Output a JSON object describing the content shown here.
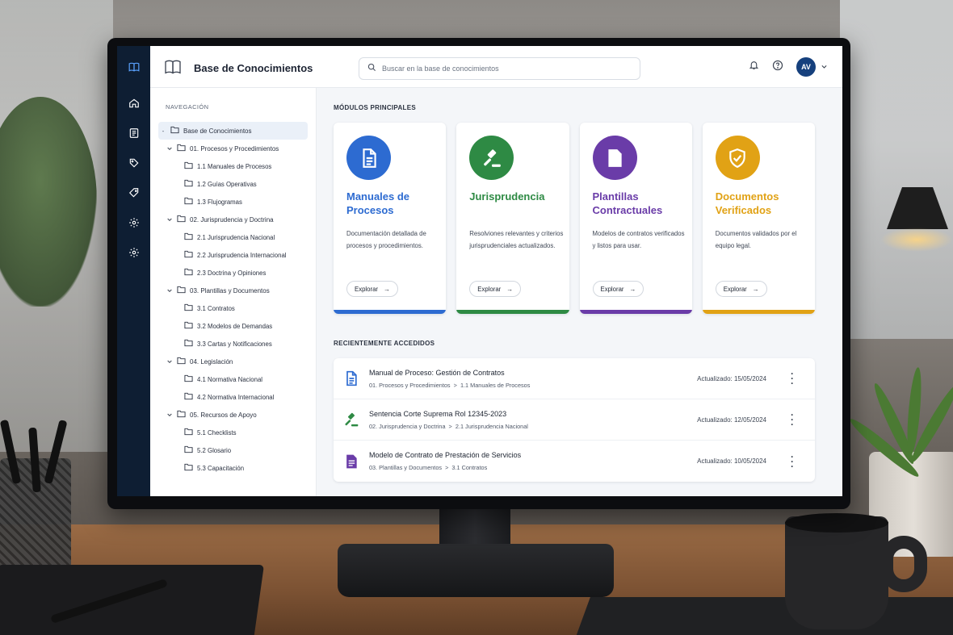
{
  "app": {
    "title": "Base de Conocimientos",
    "user_initials": "AV"
  },
  "search": {
    "placeholder": "Buscar en la base de conocimientos"
  },
  "rail": {
    "items": [
      "home-icon",
      "document-icon",
      "tag-icon",
      "label-icon",
      "settings-icon",
      "gear-icon"
    ]
  },
  "nav": {
    "heading": "NAVEGACIÓN",
    "root": "Base de Conocimientos",
    "groups": [
      {
        "label": "01. Procesos y Procedimientos",
        "items": [
          "1.1 Manuales de Procesos",
          "1.2 Guías Operativas",
          "1.3 Flujogramas"
        ]
      },
      {
        "label": "02. Jurisprudencia y Doctrina",
        "items": [
          "2.1 Jurisprudencia Nacional",
          "2.2 Jurisprudencia Internacional",
          "2.3 Doctrina y Opiniones"
        ]
      },
      {
        "label": "03. Plantillas y Documentos",
        "items": [
          "3.1 Contratos",
          "3.2 Modelos de Demandas",
          "3.3 Cartas y Notificaciones"
        ]
      },
      {
        "label": "04. Legislación",
        "items": [
          "4.1 Normativa Nacional",
          "4.2 Normativa Internacional"
        ]
      },
      {
        "label": "05. Recursos de Apoyo",
        "items": [
          "5.1 Checklists",
          "5.2 Glosario",
          "5.3 Capacitación"
        ]
      }
    ]
  },
  "modules": {
    "heading": "MÓDULOS PRINCIPALES",
    "cards": [
      {
        "title_1": "Manuales de",
        "title_2": "Procesos",
        "desc": "Documentación detallada de procesos y procedimientos.",
        "button": "Explorar",
        "color": "#2d6bd1",
        "icon": "document-icon"
      },
      {
        "title_1": "Jurisprudencia",
        "title_2": "",
        "desc": "Resolviones relevantes y criterios jurisprudenciales actualizados.",
        "button": "Explorar",
        "color": "#2e8a44",
        "icon": "gavel-icon"
      },
      {
        "title_1": "Plantillas",
        "title_2": "Contractuales",
        "desc": "Modelos de contratos verificados y listos para usar.",
        "button": "Explorar",
        "color": "#6a3ca8",
        "icon": "template-icon"
      },
      {
        "title_1": "Documentos",
        "title_2": "Verificados",
        "desc": "Documentos validados por el equipo legal.",
        "button": "Explorar",
        "color": "#e1a215",
        "icon": "shield-check-icon"
      }
    ]
  },
  "recent": {
    "heading": "RECIENTEMENTE ACCEDIDOS",
    "items": [
      {
        "title": "Manual de Proceso: Gestión de Contratos",
        "path_1": "01. Procesos y Procedimientos",
        "path_2": "1.1 Manuales de Procesos",
        "date": "Actualizado: 15/05/2024",
        "icon": "document-icon",
        "color": "#2d6bd1"
      },
      {
        "title": "Sentencia Corte Suprema Rol 12345-2023",
        "path_1": "02. Jurisprudencia y Doctrina",
        "path_2": "2.1 Jurisprudencia Nacional",
        "date": "Actualizado: 12/05/2024",
        "icon": "gavel-icon",
        "color": "#2e8a44"
      },
      {
        "title": "Modelo de Contrato de Prestación de Servicios",
        "path_1": "03. Plantillas y Documentos",
        "path_2": "3.1 Contratos",
        "date": "Actualizado: 10/05/2024",
        "icon": "template-icon",
        "color": "#6a3ca8"
      }
    ]
  }
}
